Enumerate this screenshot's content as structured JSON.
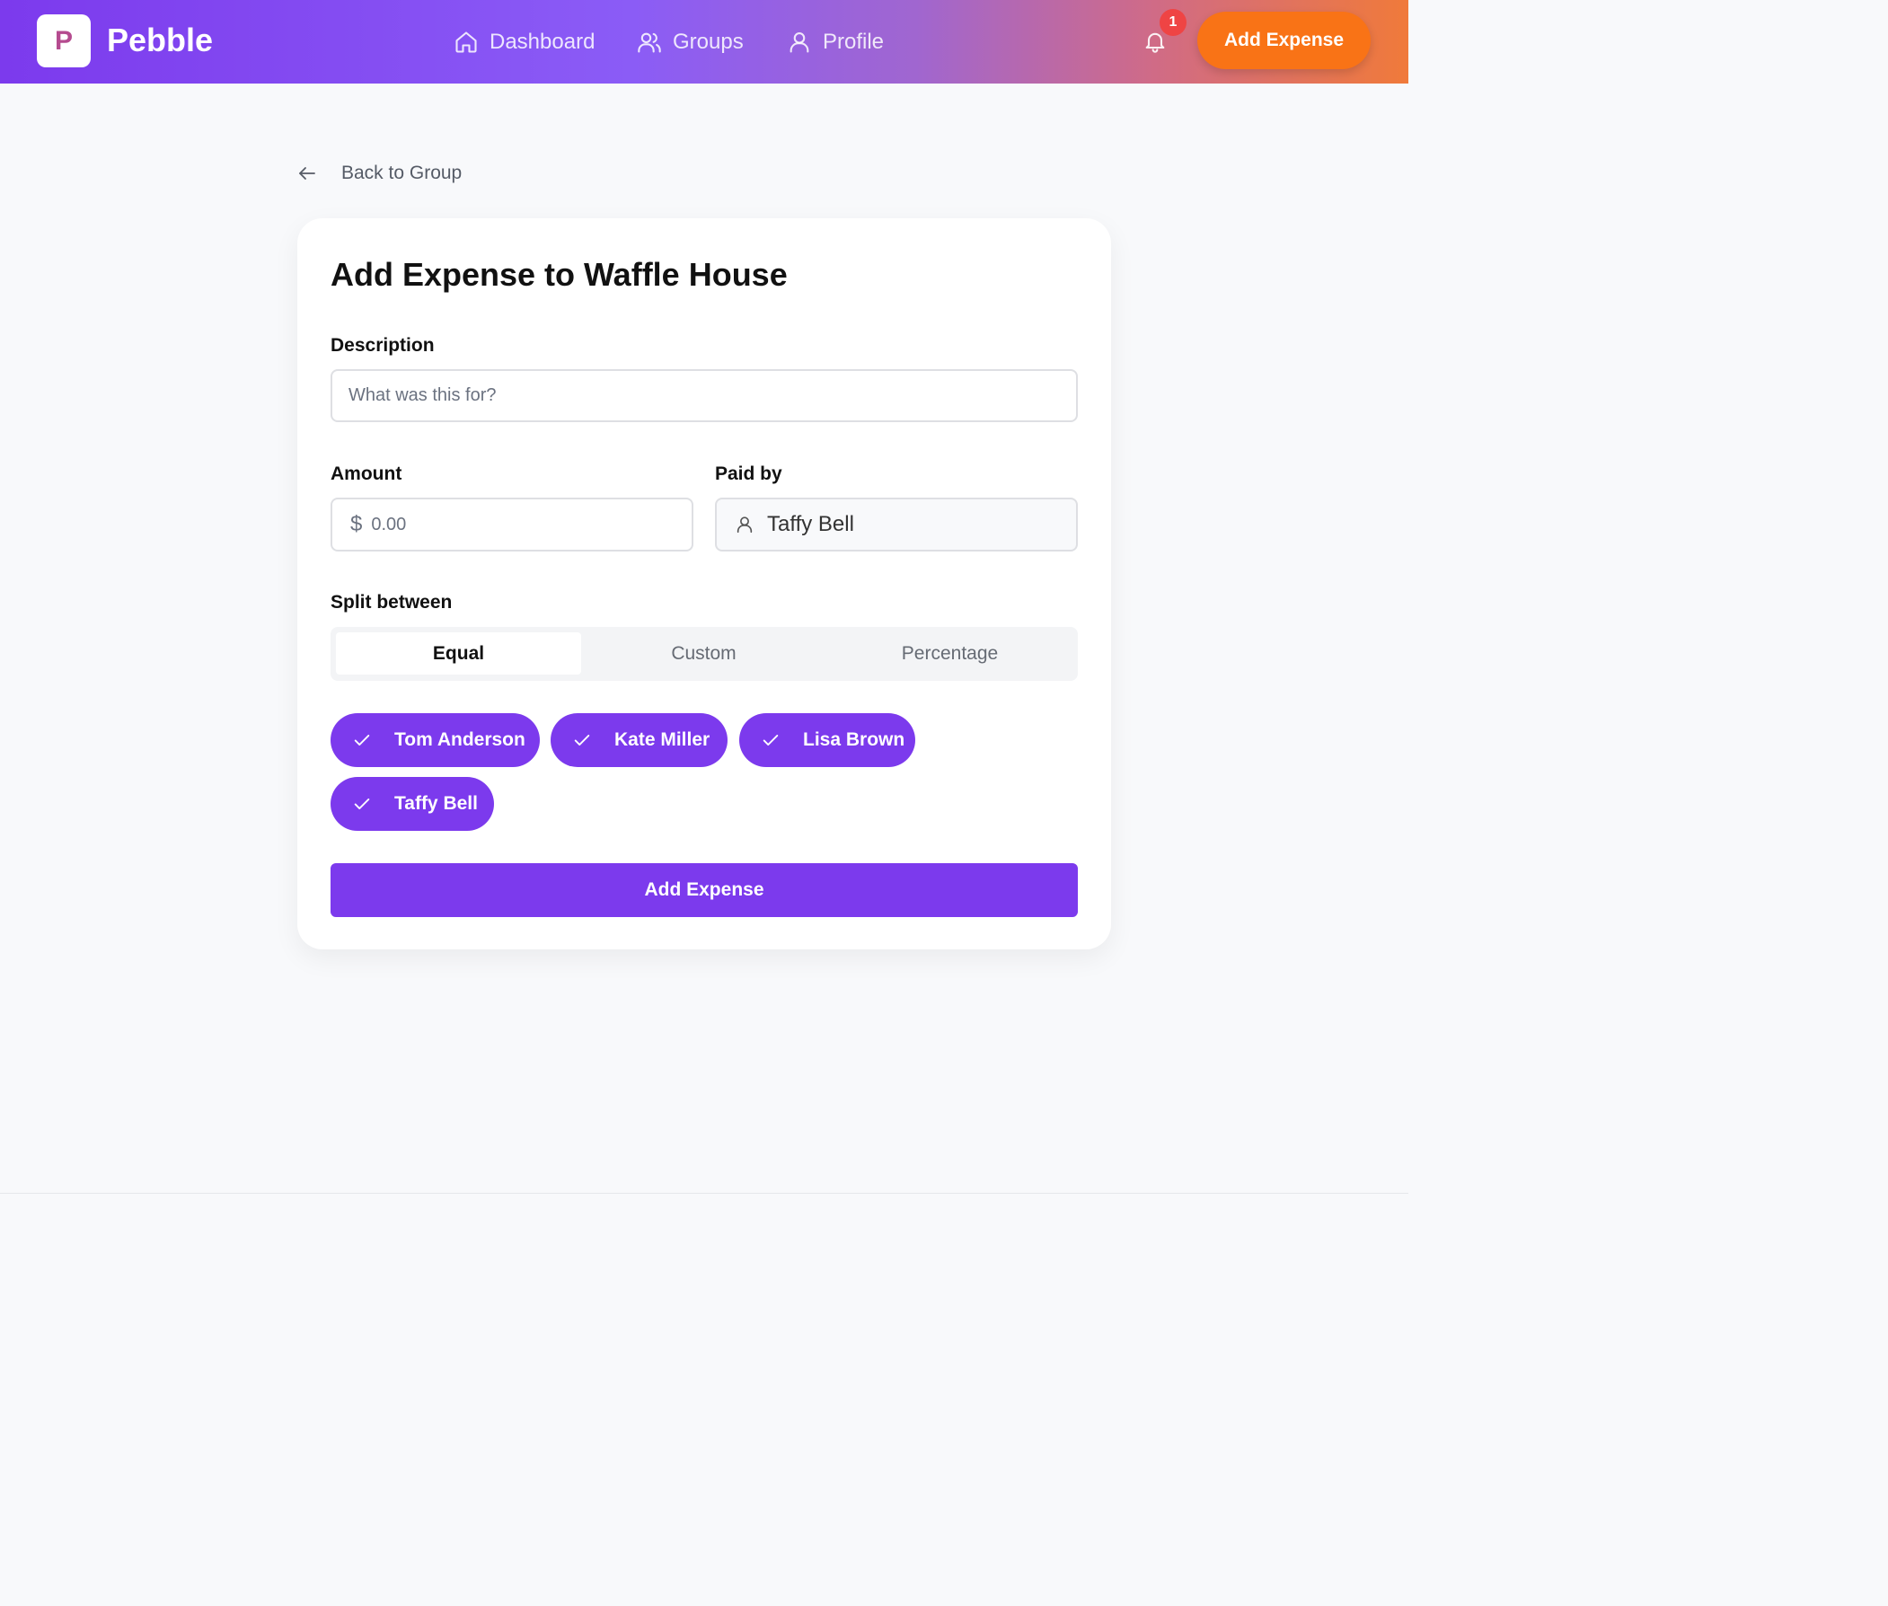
{
  "header": {
    "logo_letter": "P",
    "brand": "Pebble",
    "nav": [
      {
        "label": "Dashboard",
        "icon": "home-icon"
      },
      {
        "label": "Groups",
        "icon": "users-icon"
      },
      {
        "label": "Profile",
        "icon": "user-icon"
      }
    ],
    "notification_count": "1",
    "add_expense_label": "Add Expense"
  },
  "back_link": "Back to Group",
  "form": {
    "title": "Add Expense to Waffle House",
    "description_label": "Description",
    "description_placeholder": "What was this for?",
    "amount_label": "Amount",
    "currency_symbol": "$",
    "amount_placeholder": "0.00",
    "paid_by_label": "Paid by",
    "paid_by_value": "Taffy Bell",
    "split_label": "Split between",
    "split_modes": [
      "Equal",
      "Custom",
      "Percentage"
    ],
    "active_split_mode": "Equal",
    "members": [
      "Tom Anderson",
      "Kate Miller",
      "Lisa Brown",
      "Taffy Bell"
    ],
    "submit_label": "Add Expense"
  },
  "colors": {
    "primary": "#7c3aed",
    "accent": "#f97316",
    "badge": "#ef4444"
  }
}
